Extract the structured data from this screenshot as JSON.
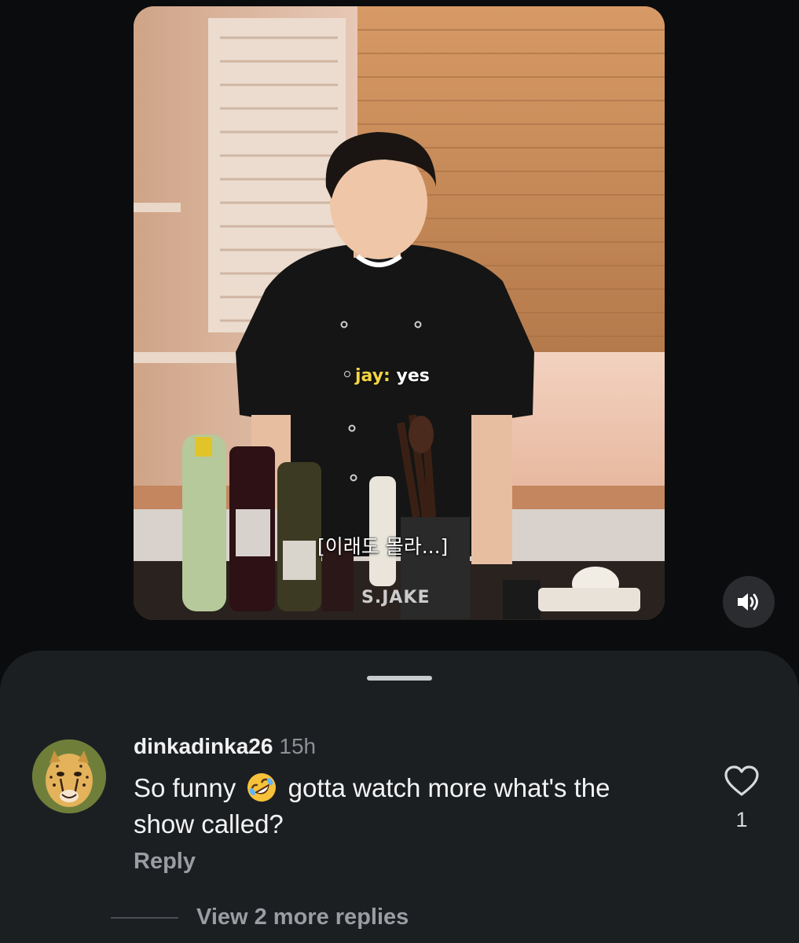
{
  "video": {
    "caption_speaker": "jay:",
    "caption_text": "yes",
    "subtitle": "[이래도 몰라...]",
    "watermark": "S.JAKE",
    "volume_icon": "volume-on-icon"
  },
  "comment": {
    "username": "dinkadinka26",
    "time": "15h",
    "text_before_emoji": "So funny",
    "emoji": "rolling-on-floor-laughing-emoji",
    "text_after_emoji": "gotta watch more what's the show called?",
    "reply_label": "Reply",
    "like_icon": "heart-outline-icon",
    "like_count": "1",
    "view_more_replies": "View 2 more replies"
  },
  "colors": {
    "background": "#0b0c0d",
    "sheet": "#1c1f22",
    "caption_speaker": "#f3d443",
    "muted_text": "#9a9da1"
  }
}
